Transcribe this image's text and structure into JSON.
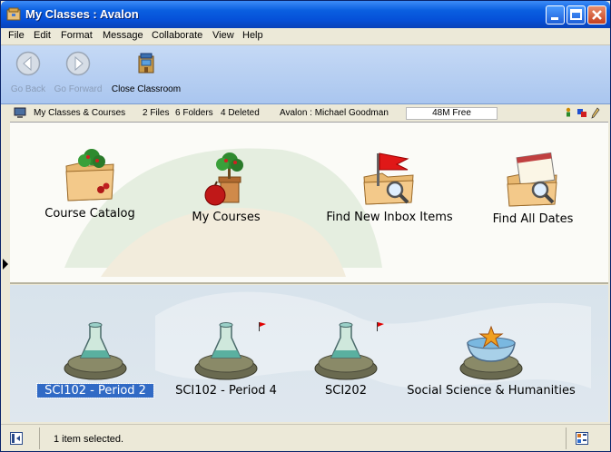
{
  "window": {
    "title": "My Classes : Avalon"
  },
  "menu": [
    "File",
    "Edit",
    "Format",
    "Message",
    "Collaborate",
    "View",
    "Help"
  ],
  "toolbar": {
    "back": "Go Back",
    "forward": "Go Forward",
    "close_classroom": "Close Classroom"
  },
  "info": {
    "location": "My Classes & Courses",
    "files": "2 Files",
    "folders": "6 Folders",
    "deleted": "4 Deleted",
    "user": "Avalon : Michael Goodman",
    "free": "48M Free"
  },
  "upper_items": [
    {
      "label": "Course Catalog",
      "icon": "course-catalog-icon"
    },
    {
      "label": "My Courses",
      "icon": "my-courses-icon"
    },
    {
      "label": "Find New Inbox Items",
      "icon": "find-inbox-icon"
    },
    {
      "label": "Find All Dates",
      "icon": "find-dates-icon"
    }
  ],
  "lower_items": [
    {
      "label": "SCI102 - Period 2",
      "icon": "flask-icon",
      "selected": true,
      "flag": false
    },
    {
      "label": "SCI102 - Period 4",
      "icon": "flask-icon",
      "selected": false,
      "flag": true
    },
    {
      "label": "SCI202",
      "icon": "flask-icon",
      "selected": false,
      "flag": true
    },
    {
      "label": "Social Science & Humanities",
      "icon": "globe-bowl-icon",
      "selected": false,
      "flag": false
    }
  ],
  "status": {
    "text": "1 item selected."
  },
  "colors": {
    "titlebar": "#0650d8",
    "selection": "#316ac5",
    "flag": "#e00000"
  }
}
